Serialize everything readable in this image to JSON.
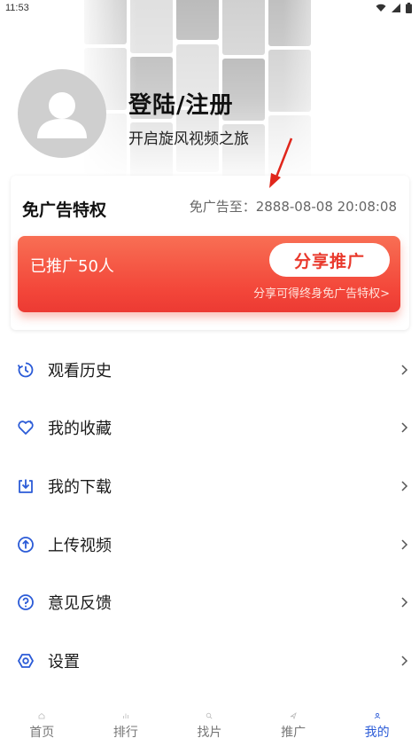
{
  "status_bar": {
    "time": "11:53"
  },
  "profile": {
    "title": "登陆/注册",
    "subtitle": "开启旋风视频之旅"
  },
  "vip": {
    "title": "免广告特权",
    "expire_label": "免广告至：2888-08-08 20:08:08",
    "promo_count": "已推广50人",
    "share_button": "分享推广",
    "promo_note": "分享可得终身免广告特权>"
  },
  "menu": [
    {
      "label": "观看历史",
      "icon": "history-icon"
    },
    {
      "label": "我的收藏",
      "icon": "favorite-icon"
    },
    {
      "label": "我的下载",
      "icon": "download-icon"
    },
    {
      "label": "上传视频",
      "icon": "upload-icon"
    },
    {
      "label": "意见反馈",
      "icon": "feedback-icon"
    },
    {
      "label": "设置",
      "icon": "settings-icon"
    }
  ],
  "bottom_nav": [
    {
      "label": "首页",
      "active": false
    },
    {
      "label": "排行",
      "active": false
    },
    {
      "label": "找片",
      "active": false
    },
    {
      "label": "推广",
      "active": false
    },
    {
      "label": "我的",
      "active": true
    }
  ],
  "colors": {
    "accent": "#2b5bd7",
    "promo_red": "#f3473a",
    "arrow_red": "#e0261b"
  }
}
